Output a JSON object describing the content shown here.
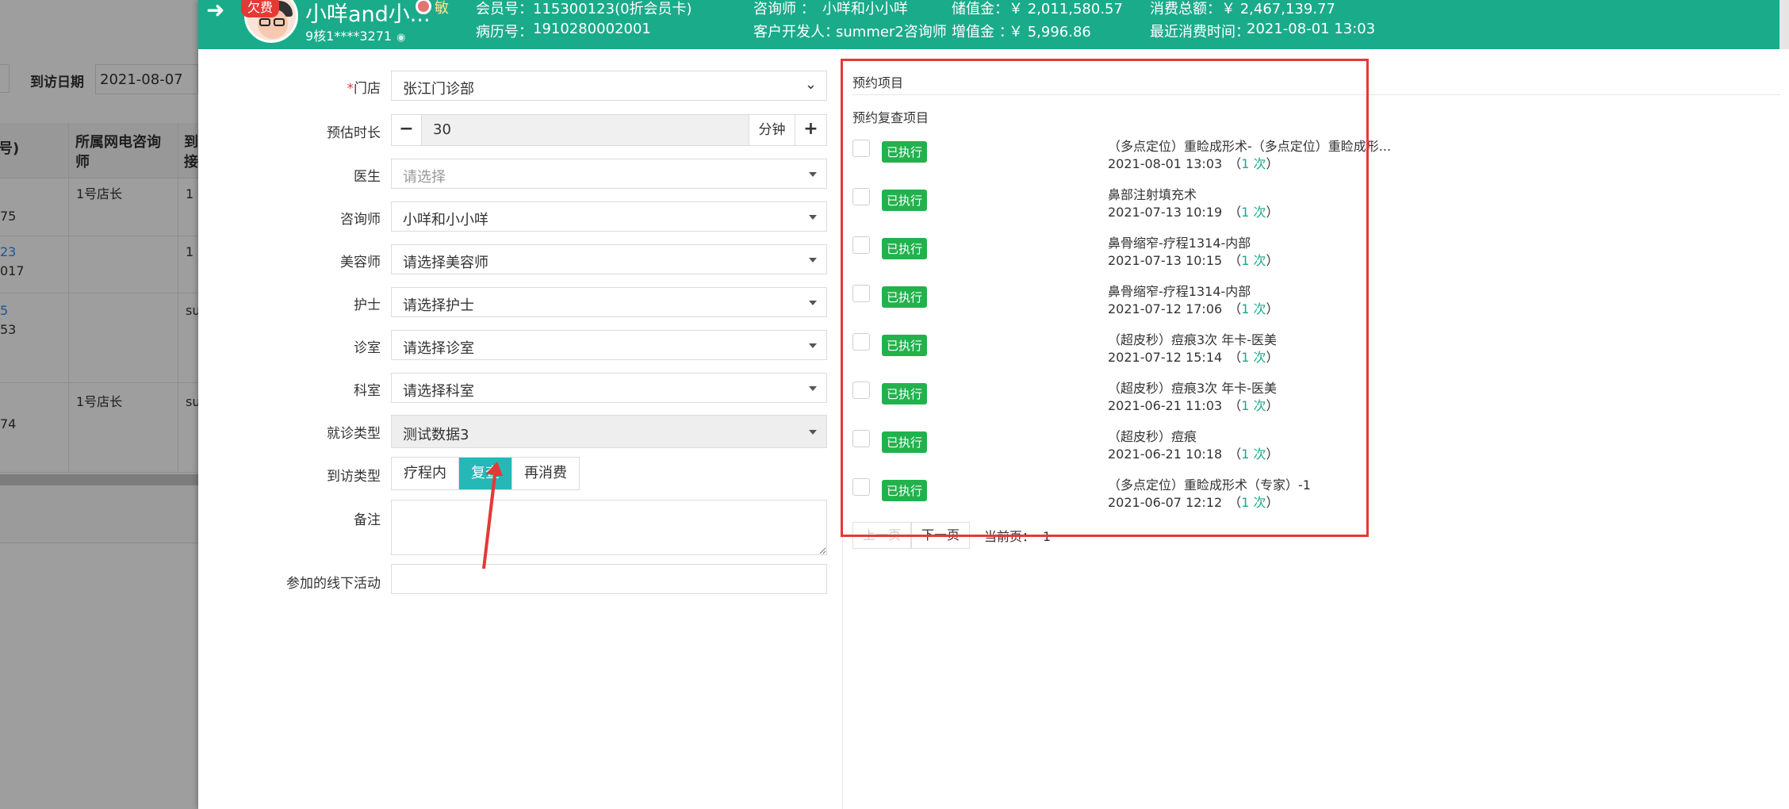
{
  "background": {
    "filter_label": "到访日期",
    "filter_date": "2021-08-07",
    "columns": [
      "号)",
      "所属网电咨询师",
      "到接"
    ],
    "rows": [
      {
        "c1": "75",
        "c2": "1号店长",
        "c3": "1"
      },
      {
        "c1": "23",
        "c1b": "017",
        "c2": "",
        "c3": "1"
      },
      {
        "c1": "5",
        "c1b": "53",
        "c2": "",
        "c3": "su"
      },
      {
        "c1": "74",
        "c2": "1号店长",
        "c3": "su"
      }
    ]
  },
  "header": {
    "debt_badge": "欠费",
    "customer_name": "小咩and小...",
    "tag": "敏",
    "phone": "9核1****3271",
    "member_no_label": "会员号：",
    "member_no": "115300123(0折会员卡)",
    "record_no_label": "病历号：",
    "record_no": "1910280002001",
    "consultant_label": "咨询师 ：",
    "consultant": "小咩和小小咩",
    "developer_label": "客户开发人：",
    "developer": "summer2咨询师",
    "stored_label": "储值金：",
    "stored_value": "￥ 2,011,580.57",
    "bonus_label": "增值金 ：",
    "bonus_value": "￥ 5,996.86",
    "total_label": "消费总额：",
    "total_value": "￥ 2,467,139.77",
    "last_label": "最近消费时间：",
    "last_value": "2021-08-01 13:03"
  },
  "form": {
    "store_label": "门店",
    "store_value": "张江门诊部",
    "duration_label": "预估时长",
    "duration_value": "30",
    "duration_unit": "分钟",
    "doctor_label": "医生",
    "doctor_placeholder": "请选择",
    "consultant_label": "咨询师",
    "consultant_value": "小咩和小小咩",
    "beautician_label": "美容师",
    "beautician_placeholder": "请选择美容师",
    "nurse_label": "护士",
    "nurse_placeholder": "请选择护士",
    "room_label": "诊室",
    "room_placeholder": "请选择诊室",
    "dept_label": "科室",
    "dept_placeholder": "请选择科室",
    "visit_kind_label": "就诊类型",
    "visit_kind_value": "测试数据3",
    "visit_type_label": "到访类型",
    "visit_type_options": [
      "疗程内",
      "复查",
      "再消费"
    ],
    "visit_type_selected": "复查",
    "remark_label": "备注",
    "activity_label": "参加的线下活动"
  },
  "projects": {
    "title": "预约项目",
    "subtitle": "预约复查项目",
    "badge_label": "已执行",
    "items": [
      {
        "name": "（多点定位）重睑成形术-（多点定位）重睑成形...",
        "time": "2021-08-01 13:03",
        "count": "1 次"
      },
      {
        "name": "鼻部注射填充术",
        "time": "2021-07-13 10:19",
        "count": "1 次"
      },
      {
        "name": "鼻骨缩窄-疗程1314-内部",
        "time": "2021-07-13 10:15",
        "count": "1 次"
      },
      {
        "name": "鼻骨缩窄-疗程1314-内部",
        "time": "2021-07-12 17:06",
        "count": "1 次"
      },
      {
        "name": "（超皮秒）痘痕3次 年卡-医美",
        "time": "2021-07-12 15:14",
        "count": "1 次"
      },
      {
        "name": "（超皮秒）痘痕3次 年卡-医美",
        "time": "2021-06-21 11:03",
        "count": "1 次"
      },
      {
        "name": "（超皮秒）痘痕",
        "time": "2021-06-21 10:18",
        "count": "1 次"
      },
      {
        "name": "（多点定位）重睑成形术（专家）-1",
        "time": "2021-06-07 12:12",
        "count": "1 次"
      }
    ],
    "pager_prev": "上一页",
    "pager_next": "下一页",
    "pager_current_label": "当前页：",
    "pager_current": "1"
  },
  "colors": {
    "header_bg": "#1aab8a",
    "selected_tab": "#26b7b7",
    "executed_badge": "#22b24c",
    "highlight_frame": "#e53935"
  }
}
